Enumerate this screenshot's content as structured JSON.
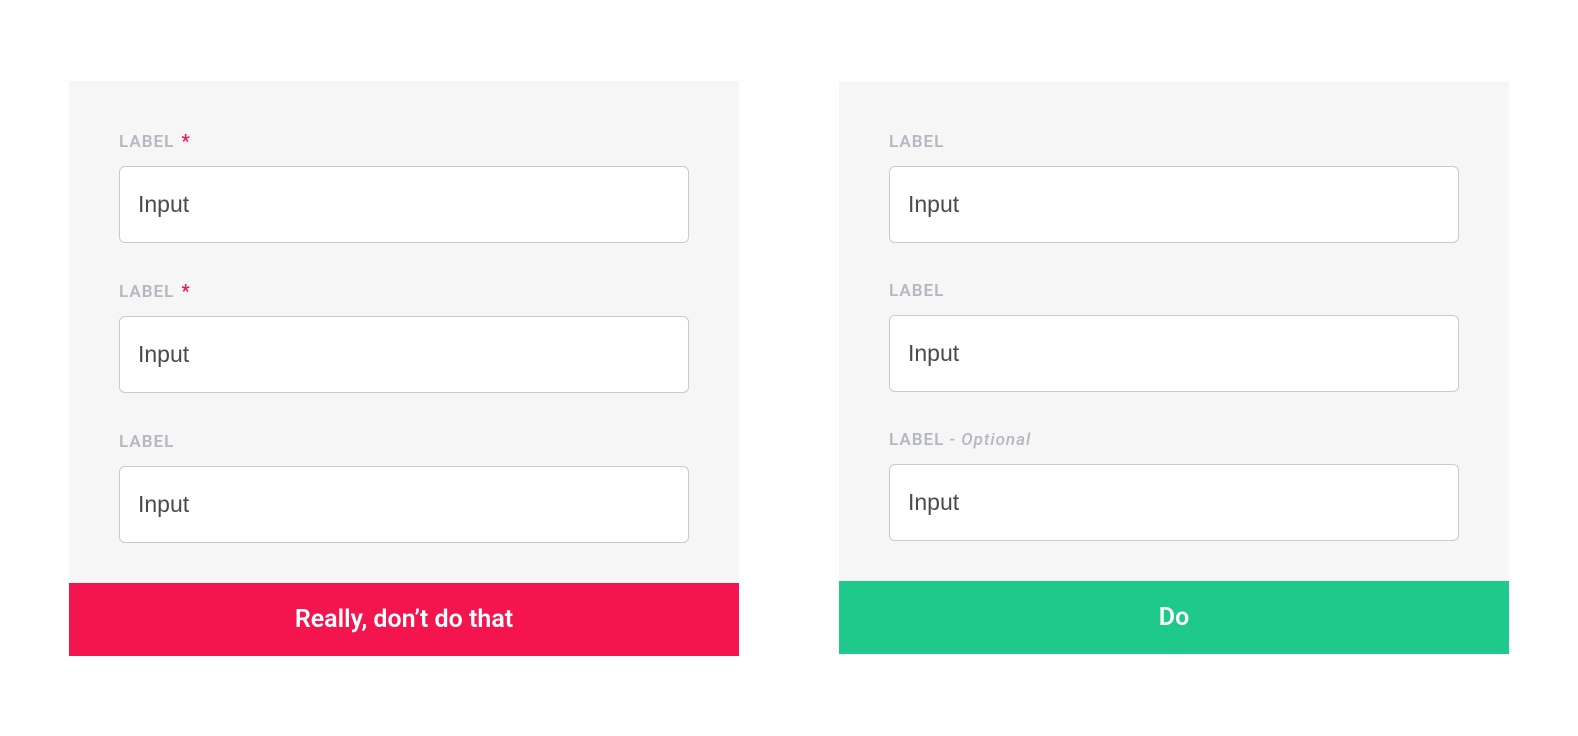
{
  "colors": {
    "dont": "#f5154e",
    "do": "#1ec98b",
    "labelText": "#b5b8c0",
    "inputBorder": "#c8cad2",
    "inputText": "#4a4a4a"
  },
  "left": {
    "fields": [
      {
        "label": "LABEL",
        "required_marker": "*",
        "value": "Input"
      },
      {
        "label": "LABEL",
        "required_marker": "*",
        "value": "Input"
      },
      {
        "label": "LABEL",
        "required_marker": "",
        "value": "Input"
      }
    ],
    "footer": "Really, don’t do that"
  },
  "right": {
    "fields": [
      {
        "label": "LABEL",
        "optional_suffix": "",
        "value": "Input"
      },
      {
        "label": "LABEL",
        "optional_suffix": "",
        "value": "Input"
      },
      {
        "label": "LABEL",
        "optional_suffix": " - Optional",
        "value": "Input"
      }
    ],
    "footer": "Do"
  }
}
